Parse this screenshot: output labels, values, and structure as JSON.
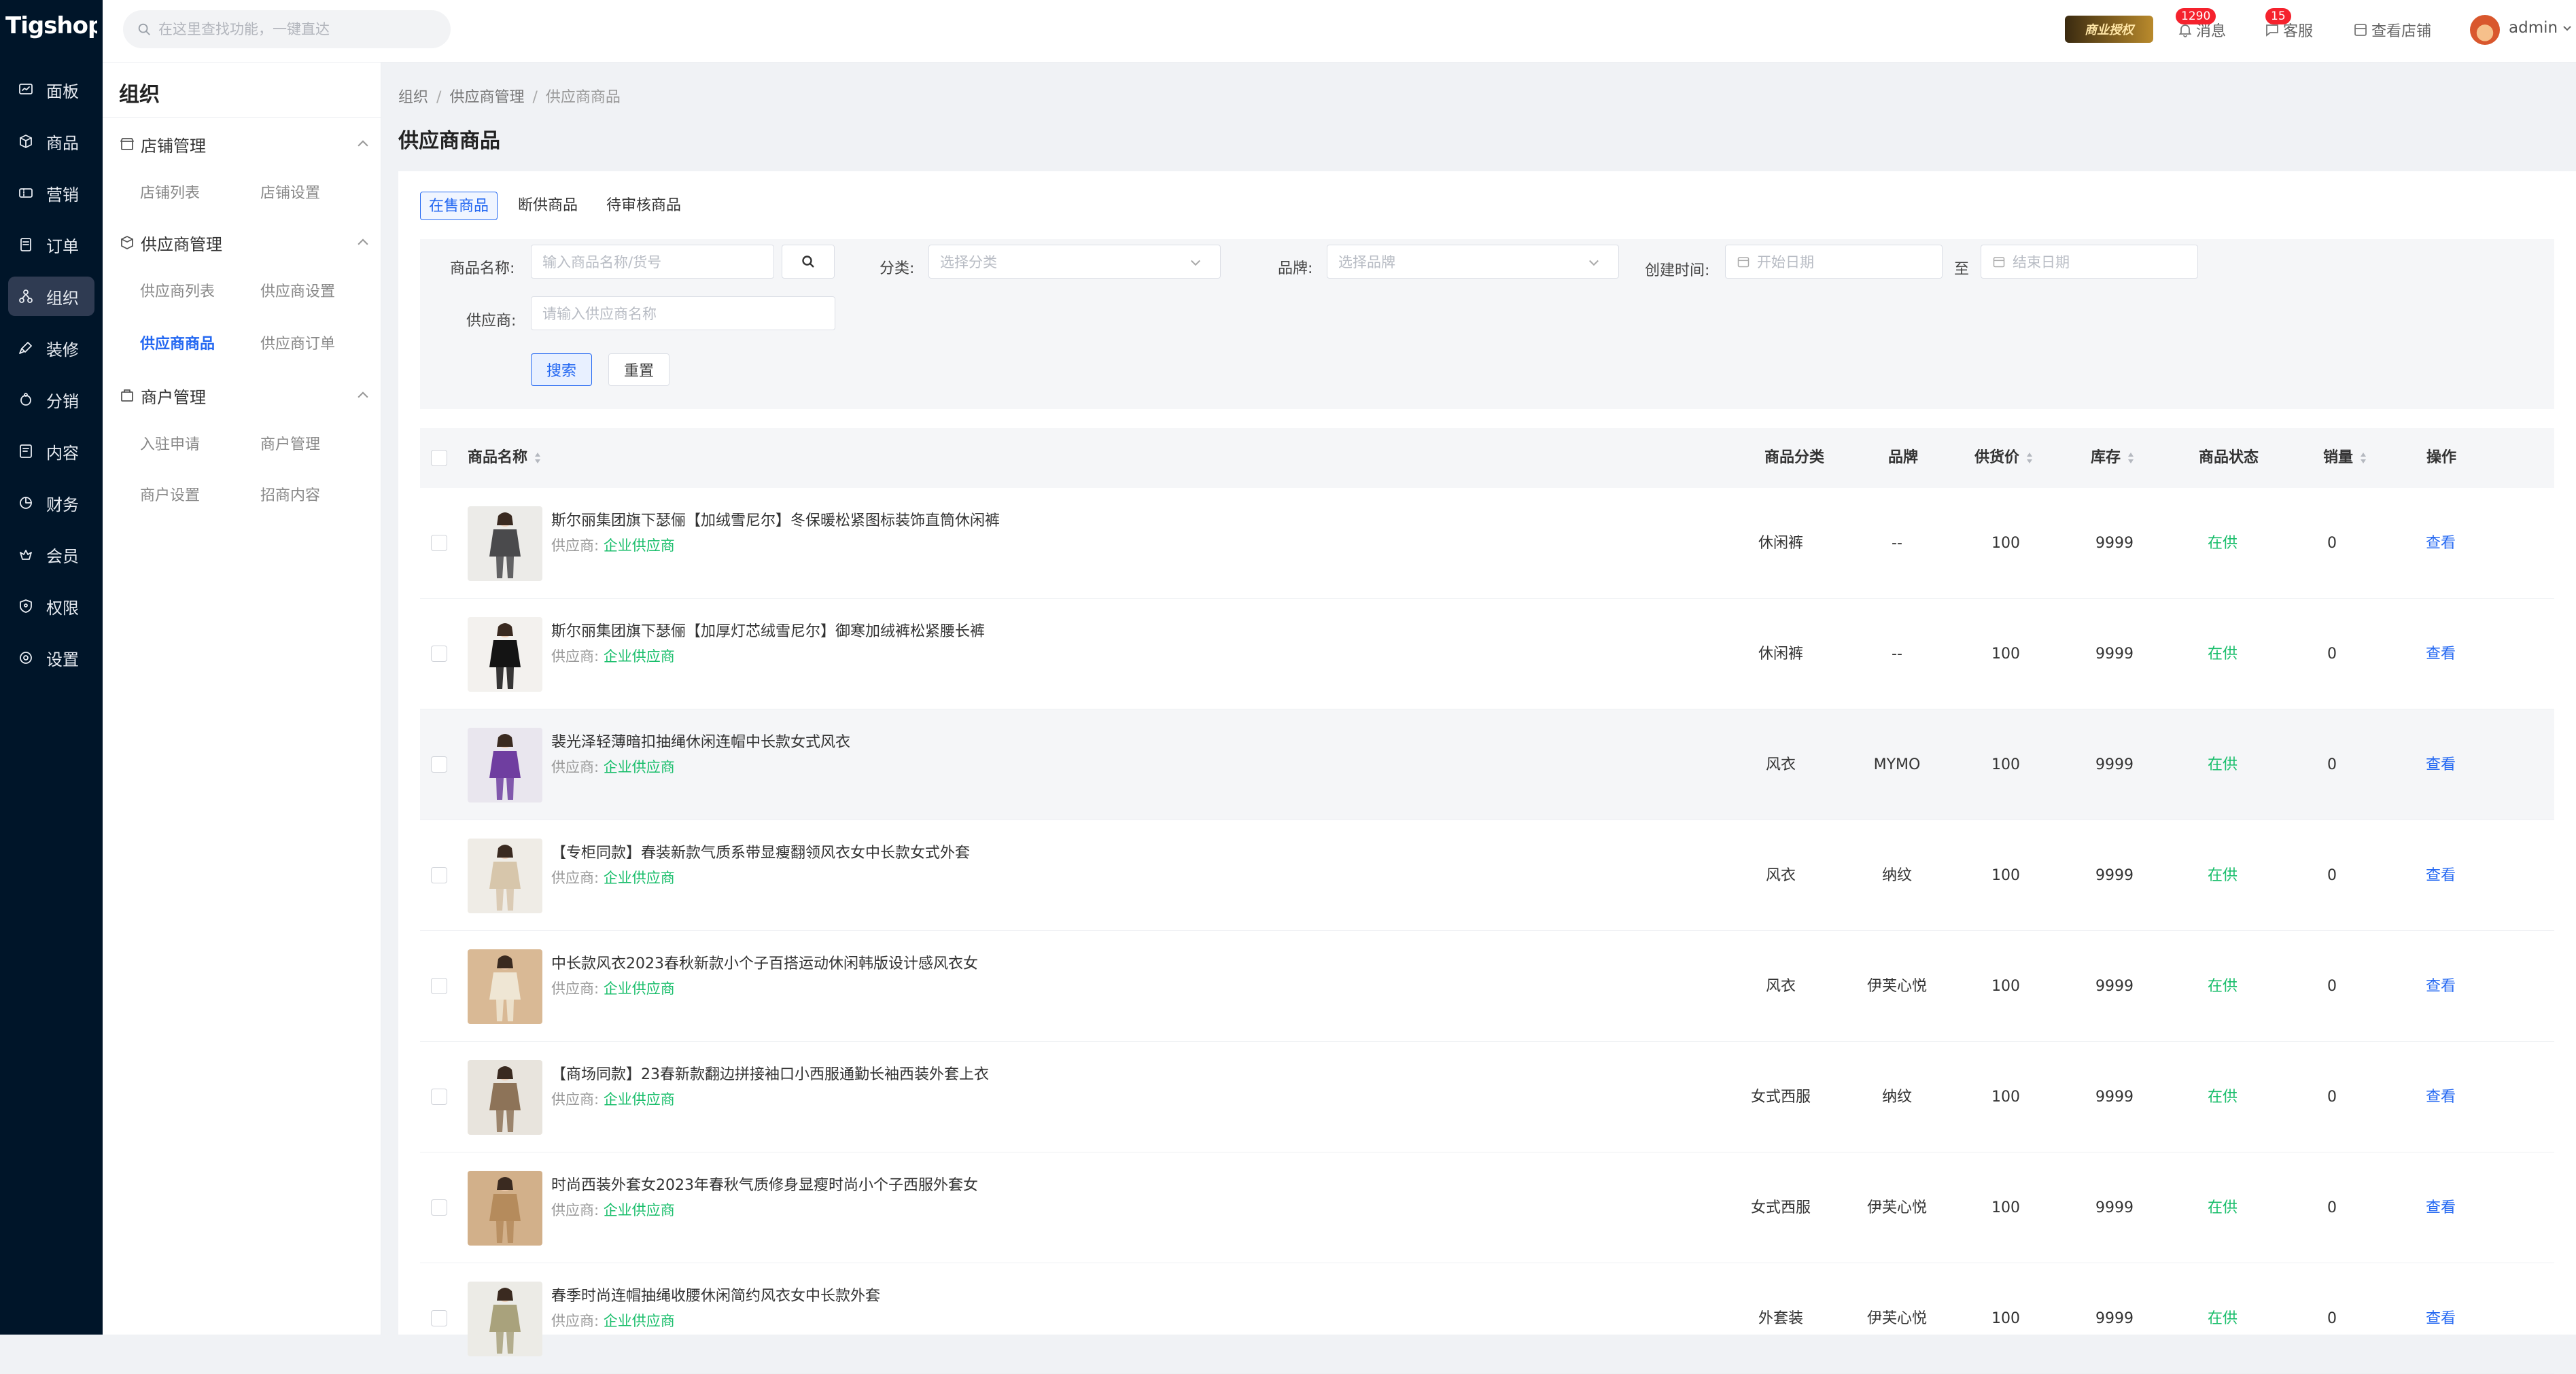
{
  "app": {
    "logo": "Tigshop"
  },
  "nav": [
    {
      "label": "面板",
      "icon": "dashboard-icon",
      "active": false
    },
    {
      "label": "商品",
      "icon": "package-icon",
      "active": false
    },
    {
      "label": "营销",
      "icon": "coupon-icon",
      "active": false
    },
    {
      "label": "订单",
      "icon": "order-icon",
      "active": false
    },
    {
      "label": "组织",
      "icon": "org-icon",
      "active": true
    },
    {
      "label": "装修",
      "icon": "brush-icon",
      "active": false
    },
    {
      "label": "分销",
      "icon": "share-icon",
      "active": false
    },
    {
      "label": "内容",
      "icon": "content-icon",
      "active": false
    },
    {
      "label": "财务",
      "icon": "finance-icon",
      "active": false
    },
    {
      "label": "会员",
      "icon": "member-icon",
      "active": false
    },
    {
      "label": "权限",
      "icon": "shield-icon",
      "active": false
    },
    {
      "label": "设置",
      "icon": "gear-icon",
      "active": false
    }
  ],
  "submenu": {
    "title": "组织",
    "groups": [
      {
        "label": "店铺管理",
        "icon": "store-icon",
        "links": [
          {
            "label": "店铺列表",
            "active": false
          },
          {
            "label": "店铺设置",
            "active": false
          }
        ]
      },
      {
        "label": "供应商管理",
        "icon": "supplier-icon",
        "links": [
          {
            "label": "供应商列表",
            "active": false
          },
          {
            "label": "供应商设置",
            "active": false
          },
          {
            "label": "供应商商品",
            "active": true
          },
          {
            "label": "供应商订单",
            "active": false
          }
        ]
      },
      {
        "label": "商户管理",
        "icon": "merchant-icon",
        "links": [
          {
            "label": "入驻申请",
            "active": false
          },
          {
            "label": "商户管理",
            "active": false
          },
          {
            "label": "商户设置",
            "active": false
          },
          {
            "label": "招商内容",
            "active": false
          }
        ]
      }
    ]
  },
  "topbar": {
    "search_placeholder": "在这里查找功能，一键直达",
    "license": "商业授权",
    "messages": {
      "label": "消息",
      "count": "1290"
    },
    "service": {
      "label": "客服",
      "count": "15"
    },
    "view_store": "查看店铺",
    "user": "admin"
  },
  "breadcrumb": [
    "组织",
    "供应商管理",
    "供应商商品"
  ],
  "page_title": "供应商商品",
  "tabs": [
    {
      "label": "在售商品",
      "active": true
    },
    {
      "label": "断供商品",
      "active": false
    },
    {
      "label": "待审核商品",
      "active": false
    }
  ],
  "filters": {
    "name_label": "商品名称:",
    "name_placeholder": "输入商品名称/货号",
    "category_label": "分类:",
    "category_placeholder": "选择分类",
    "brand_label": "品牌:",
    "brand_placeholder": "选择品牌",
    "created_label": "创建时间:",
    "start_placeholder": "开始日期",
    "range_sep": "至",
    "end_placeholder": "结束日期",
    "supplier_label": "供应商:",
    "supplier_placeholder": "请输入供应商名称",
    "search_btn": "搜索",
    "reset_btn": "重置"
  },
  "table": {
    "columns": {
      "name": "商品名称",
      "category": "商品分类",
      "brand": "品牌",
      "price": "供货价",
      "stock": "库存",
      "status": "商品状态",
      "sales": "销量",
      "action": "操作"
    },
    "supplier_prefix": "供应商:",
    "rows": [
      {
        "name": "斯尔丽集团旗下瑟俪【加绒雪尼尔】冬保暖松紧图标装饰直筒休闲裤",
        "supplier": "企业供应商",
        "category": "休闲裤",
        "brand": "--",
        "price": "100",
        "stock": "9999",
        "status": "在供",
        "sales": "0",
        "action": "查看",
        "thumb": {
          "bg": "#ecebe8",
          "garment": "#4a4a4c",
          "skin": "#f0d2bd"
        }
      },
      {
        "name": "斯尔丽集团旗下瑟俪【加厚灯芯绒雪尼尔】御寒加绒裤松紧腰长裤",
        "supplier": "企业供应商",
        "category": "休闲裤",
        "brand": "--",
        "price": "100",
        "stock": "9999",
        "status": "在供",
        "sales": "0",
        "action": "查看",
        "thumb": {
          "bg": "#f3f1ee",
          "garment": "#141414",
          "skin": "#e9c7ae"
        }
      },
      {
        "name": "裴光泽轻薄暗扣抽绳休闲连帽中长款女式风衣",
        "supplier": "企业供应商",
        "category": "风衣",
        "brand": "MYMO",
        "price": "100",
        "stock": "9999",
        "status": "在供",
        "sales": "0",
        "action": "查看",
        "thumb": {
          "bg": "#e9e6ee",
          "garment": "#6f3ea0",
          "skin": "#efd0bb"
        }
      },
      {
        "name": "【专柜同款】春装新款气质系带显瘦翻领风衣女中长款女式外套",
        "supplier": "企业供应商",
        "category": "风衣",
        "brand": "纳纹",
        "price": "100",
        "stock": "9999",
        "status": "在供",
        "sales": "0",
        "action": "查看",
        "thumb": {
          "bg": "#efece6",
          "garment": "#d7c6ab",
          "skin": "#eccdb6"
        }
      },
      {
        "name": "中长款风衣2023春秋新款小个子百搭运动休闲韩版设计感风衣女",
        "supplier": "企业供应商",
        "category": "风衣",
        "brand": "伊芙心悦",
        "price": "100",
        "stock": "9999",
        "status": "在供",
        "sales": "0",
        "action": "查看",
        "thumb": {
          "bg": "#d9b995",
          "garment": "#efe6d4",
          "skin": "#e8c4a6"
        }
      },
      {
        "name": "【商场同款】23春新款翻边拼接袖口小西服通勤长袖西装外套上衣",
        "supplier": "企业供应商",
        "category": "女式西服",
        "brand": "纳纹",
        "price": "100",
        "stock": "9999",
        "status": "在供",
        "sales": "0",
        "action": "查看",
        "thumb": {
          "bg": "#e8e4dd",
          "garment": "#8d7358",
          "skin": "#ecccb4"
        }
      },
      {
        "name": "时尚西装外套女2023年春秋气质修身显瘦时尚小个子西服外套女",
        "supplier": "企业供应商",
        "category": "女式西服",
        "brand": "伊芙心悦",
        "price": "100",
        "stock": "9999",
        "status": "在供",
        "sales": "0",
        "action": "查看",
        "thumb": {
          "bg": "#d2b08a",
          "garment": "#b58b5c",
          "skin": "#ebc6a8"
        }
      },
      {
        "name": "春季时尚连帽抽绳收腰休闲简约风衣女中长款外套",
        "supplier": "企业供应商",
        "category": "外套装",
        "brand": "伊芙心悦",
        "price": "100",
        "stock": "9999",
        "status": "在供",
        "sales": "0",
        "action": "查看",
        "thumb": {
          "bg": "#ecebe6",
          "garment": "#a9a27c",
          "skin": "#eacab2"
        }
      }
    ]
  }
}
